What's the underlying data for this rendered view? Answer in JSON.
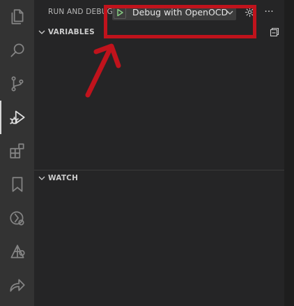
{
  "sidebar": {
    "title": "RUN AND DEBUG",
    "launch_config": {
      "selected": "Debug with OpenOCD"
    },
    "sections": {
      "variables": {
        "title": "VARIABLES"
      },
      "watch": {
        "title": "WATCH"
      }
    }
  },
  "activity_bar": {
    "items": [
      {
        "icon": "files-icon"
      },
      {
        "icon": "search-icon"
      },
      {
        "icon": "source-control-icon"
      },
      {
        "icon": "run-debug-icon",
        "active": true
      },
      {
        "icon": "extensions-icon"
      },
      {
        "icon": "bookmarks-icon"
      },
      {
        "icon": "remote-explorer-icon"
      },
      {
        "icon": "platform-icon"
      },
      {
        "icon": "live-share-icon"
      }
    ]
  },
  "colors": {
    "annotation": "#c0131c",
    "play_green": "#89d185",
    "activity_bar_bg": "#333333",
    "sidebar_bg": "#252526"
  }
}
